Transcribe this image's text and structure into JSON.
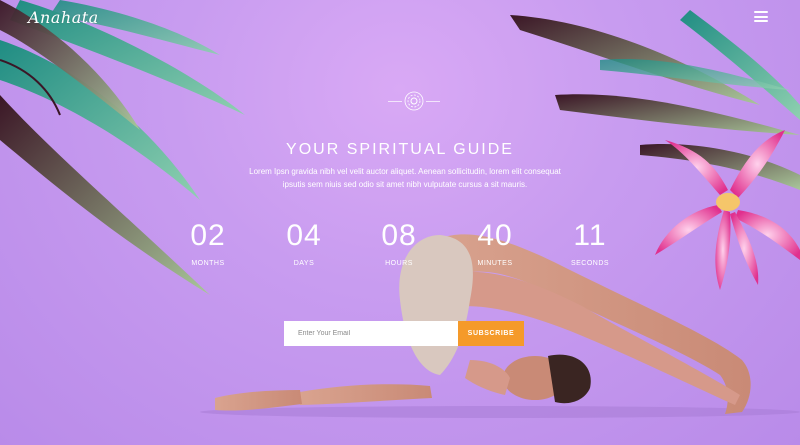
{
  "header": {
    "logo_text": "Anahata",
    "menu_icon": "hamburger-menu-icon"
  },
  "hero": {
    "ornament_icon": "mandala-icon",
    "title": "YOUR SPIRITUAL GUIDE",
    "description": "Lorem Ipsn gravida nibh vel velit auctor aliquet. Aenean sollicitudin, lorem elit consequat ipsutis sem niuis sed odio sit amet nibh vulputate cursus a sit mauris."
  },
  "countdown": [
    {
      "value": "02",
      "label": "MONTHS"
    },
    {
      "value": "04",
      "label": "DAYS"
    },
    {
      "value": "08",
      "label": "HOURS"
    },
    {
      "value": "40",
      "label": "MINUTES"
    },
    {
      "value": "11",
      "label": "SECONDS"
    }
  ],
  "subscribe": {
    "placeholder": "Enter Your Email",
    "button_label": "SUBSCRIBE"
  },
  "colors": {
    "background": "#c89cf0",
    "accent": "#f59a2a",
    "text": "#ffffff"
  }
}
